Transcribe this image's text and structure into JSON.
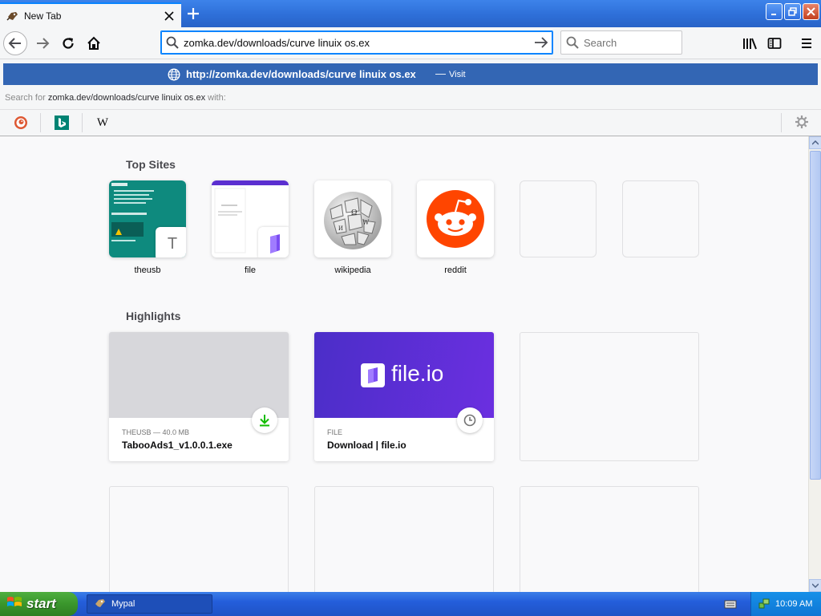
{
  "browser": {
    "tab_title": "New Tab",
    "url_value": "zomka.dev/downloads/curve linuix os.ex",
    "search_placeholder": "Search"
  },
  "urlbar_dropdown": {
    "heuristic_url": "http://zomka.dev/downloads/curve linuix os.ex",
    "heuristic_separator": "—",
    "heuristic_action": "Visit",
    "search_for_prefix": "Search for",
    "search_for_query": "zomka.dev/downloads/curve linuix os.ex",
    "search_for_suffix": "with:",
    "engines": [
      "duckduckgo-icon",
      "bing-icon",
      "wikipedia-icon"
    ],
    "wikipedia_glyph": "W"
  },
  "newtab": {
    "top_sites_title": "Top Sites",
    "highlights_title": "Highlights",
    "top_sites": [
      {
        "label": "theusb",
        "letter": "T"
      },
      {
        "label": "file"
      },
      {
        "label": "wikipedia"
      },
      {
        "label": "reddit"
      }
    ],
    "highlights": [
      {
        "context": "THEUSB — 40.0 MB",
        "title": "TabooAds1_v1.0.0.1.exe",
        "badge": "download-icon"
      },
      {
        "context": "FILE",
        "title": "Download | file.io",
        "badge": "clock-icon",
        "brand": "file.io"
      }
    ]
  },
  "taskbar": {
    "start_label": "start",
    "task_label": "Mypal",
    "clock": "10:09 AM"
  },
  "colors": {
    "accent": "#0a84ff",
    "heuristic_bg": "#3366b4",
    "theusb_tile": "#0e8a7e",
    "fileio_purple": "#5b2fd0",
    "reddit_orange": "#ff4500"
  }
}
